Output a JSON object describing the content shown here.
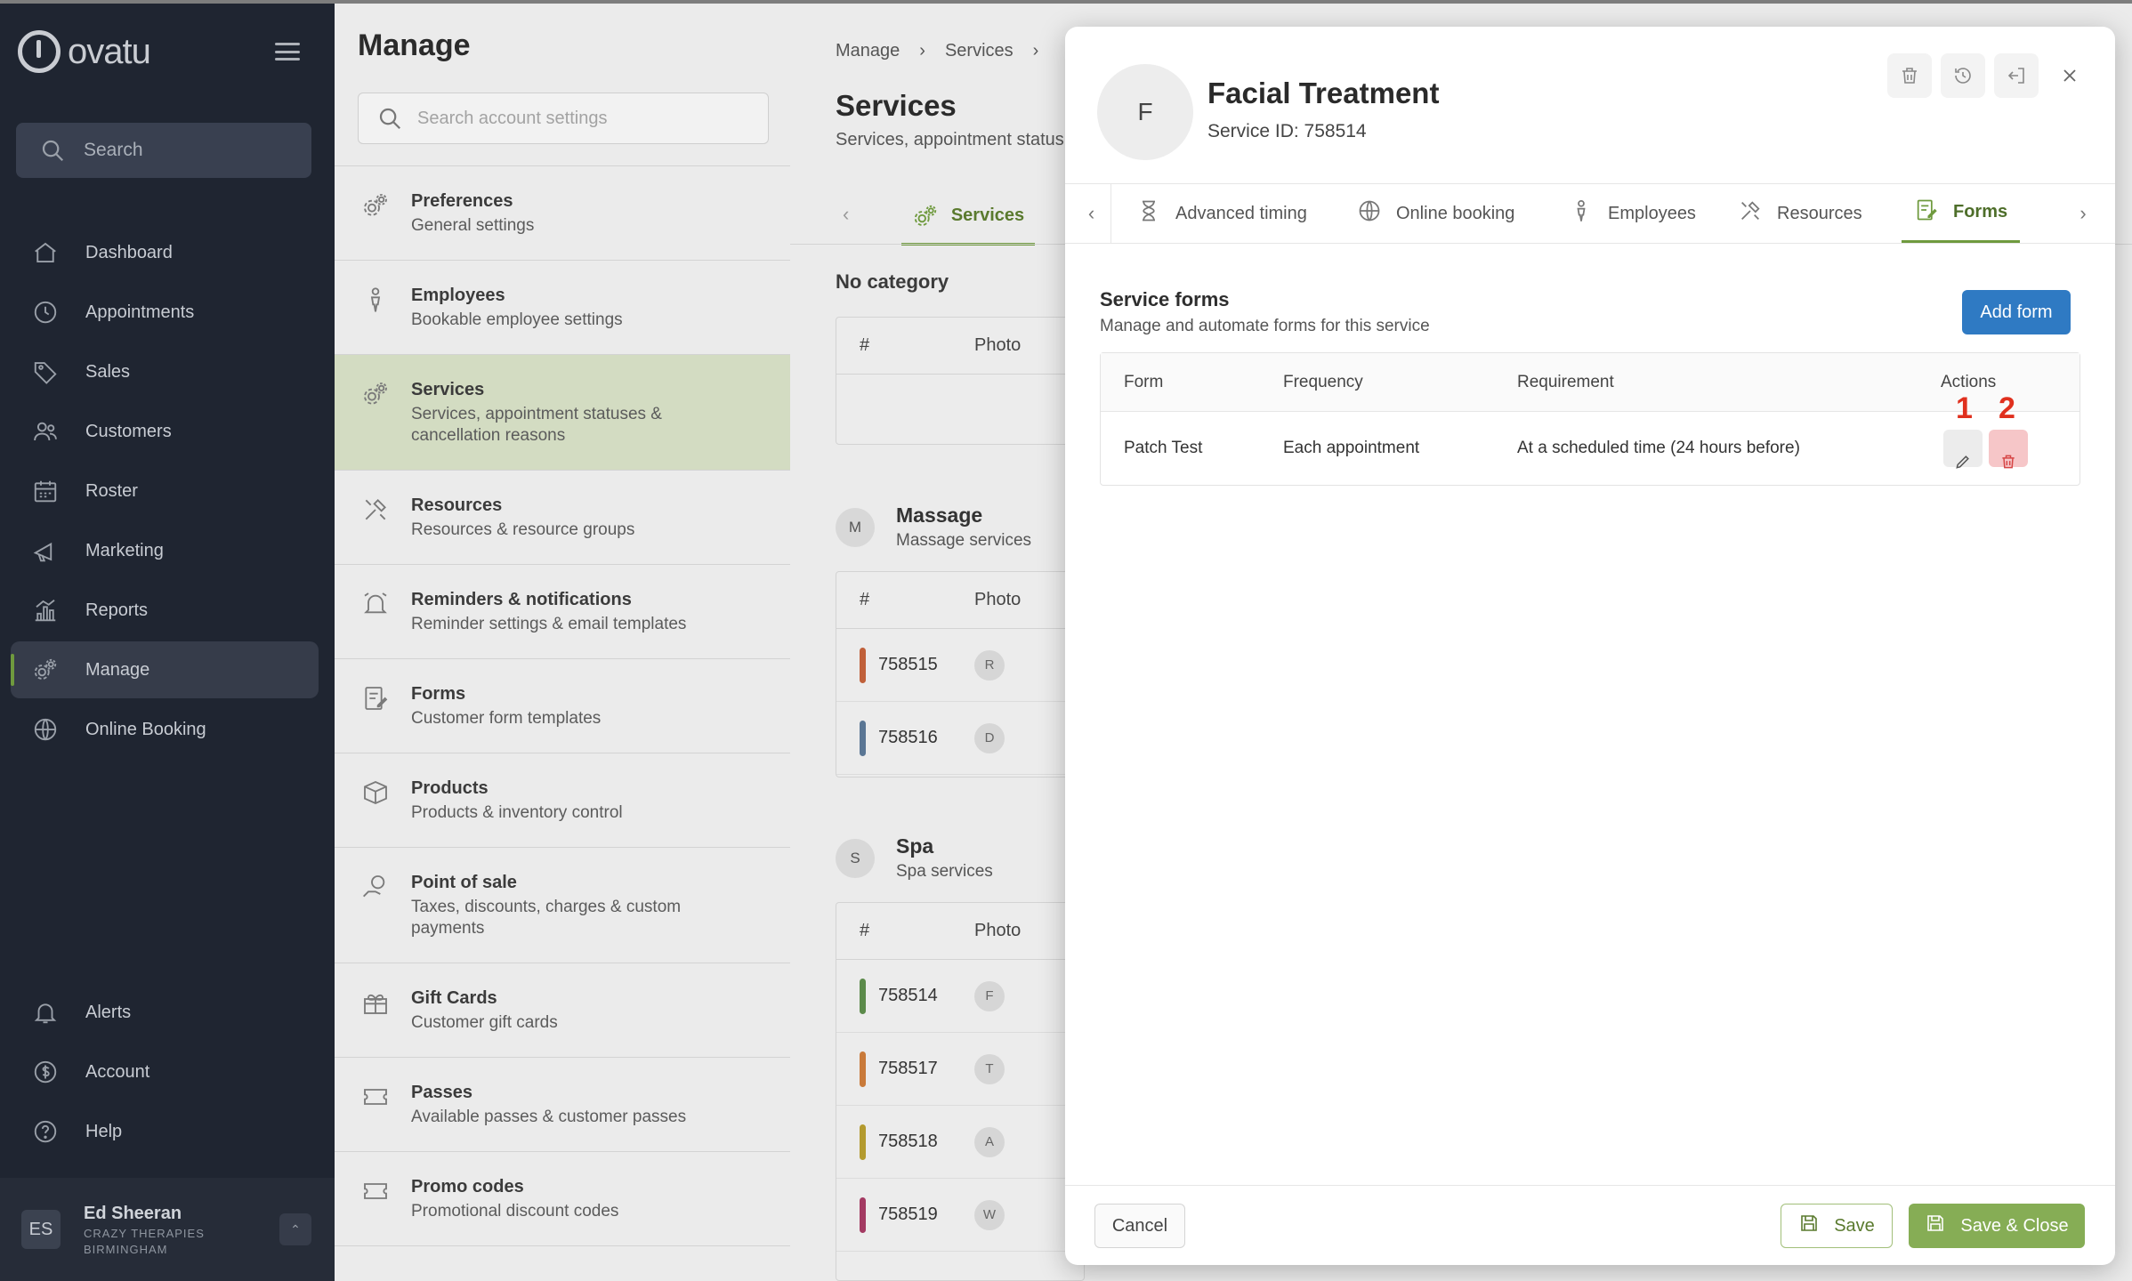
{
  "app": {
    "logo_text": "ovatu"
  },
  "sidebar": {
    "search_placeholder": "Search",
    "items": [
      {
        "label": "Dashboard",
        "icon": "home-icon"
      },
      {
        "label": "Appointments",
        "icon": "clock-icon"
      },
      {
        "label": "Sales",
        "icon": "tag-icon"
      },
      {
        "label": "Customers",
        "icon": "users-icon"
      },
      {
        "label": "Roster",
        "icon": "calendar-icon"
      },
      {
        "label": "Marketing",
        "icon": "megaphone-icon"
      },
      {
        "label": "Reports",
        "icon": "bar-chart-icon"
      },
      {
        "label": "Manage",
        "icon": "gears-icon",
        "active": true
      },
      {
        "label": "Online Booking",
        "icon": "globe-icon"
      }
    ],
    "bottom_items": [
      {
        "label": "Alerts",
        "icon": "bell-icon"
      },
      {
        "label": "Account",
        "icon": "dollar-icon"
      },
      {
        "label": "Help",
        "icon": "help-icon"
      }
    ],
    "user": {
      "initials": "ES",
      "name": "Ed Sheeran",
      "org_line1": "CRAZY THERAPIES",
      "org_line2": "BIRMINGHAM"
    }
  },
  "manage": {
    "title": "Manage",
    "search_placeholder": "Search account settings",
    "items": [
      {
        "title": "Preferences",
        "sub": "General settings"
      },
      {
        "title": "Employees",
        "sub": "Bookable employee settings"
      },
      {
        "title": "Services",
        "sub": "Services, appointment statuses & cancellation reasons",
        "active": true
      },
      {
        "title": "Resources",
        "sub": "Resources & resource groups"
      },
      {
        "title": "Reminders & notifications",
        "sub": "Reminder settings & email templates"
      },
      {
        "title": "Forms",
        "sub": "Customer form templates"
      },
      {
        "title": "Products",
        "sub": "Products & inventory control"
      },
      {
        "title": "Point of sale",
        "sub": "Taxes, discounts, charges & custom payments"
      },
      {
        "title": "Gift Cards",
        "sub": "Customer gift cards"
      },
      {
        "title": "Passes",
        "sub": "Available passes & customer passes"
      },
      {
        "title": "Promo codes",
        "sub": "Promotional discount codes"
      }
    ]
  },
  "services_page": {
    "breadcrumb": [
      "Manage",
      "Services"
    ],
    "title": "Services",
    "subtitle": "Services, appointment status",
    "tab_label": "Services",
    "no_category_label": "No category",
    "col_hash": "#",
    "col_photo": "Photo",
    "groups": [
      {
        "badge": "M",
        "name": "Massage",
        "sub": "Massage services",
        "rows": [
          {
            "id": "758515",
            "photo": "R",
            "color": "#c0603a"
          },
          {
            "id": "758516",
            "photo": "D",
            "color": "#5a7694"
          }
        ]
      },
      {
        "badge": "S",
        "name": "Spa",
        "sub": "Spa services",
        "rows": [
          {
            "id": "758514",
            "photo": "F",
            "color": "#5b8a4a"
          },
          {
            "id": "758517",
            "photo": "T",
            "color": "#c97a3a"
          },
          {
            "id": "758518",
            "photo": "A",
            "color": "#b39a2e"
          },
          {
            "id": "758519",
            "photo": "W",
            "color": "#a33a62"
          }
        ]
      }
    ]
  },
  "modal": {
    "avatar_letter": "F",
    "name": "Facial Treatment",
    "service_id": "Service ID: 758514",
    "tabs": [
      {
        "label": "Advanced timing",
        "icon": "hourglass-icon"
      },
      {
        "label": "Online booking",
        "icon": "globe-icon"
      },
      {
        "label": "Employees",
        "icon": "person-icon"
      },
      {
        "label": "Resources",
        "icon": "tools-icon"
      },
      {
        "label": "Forms",
        "icon": "form-icon",
        "active": true
      }
    ],
    "section_title": "Service forms",
    "section_sub": "Manage and automate forms for this service",
    "add_form_label": "Add form",
    "table": {
      "headers": [
        "Form",
        "Frequency",
        "Requirement",
        "Actions"
      ],
      "rows": [
        {
          "form": "Patch Test",
          "frequency": "Each appointment",
          "requirement": "At a scheduled time (24 hours before)"
        }
      ]
    },
    "markers": [
      "1",
      "2"
    ],
    "footer": {
      "cancel": "Cancel",
      "save": "Save",
      "save_close": "Save & Close"
    },
    "colors": {
      "accent": "#6f9a3e",
      "primary": "#2f7ac3",
      "danger": "#d64545"
    }
  }
}
